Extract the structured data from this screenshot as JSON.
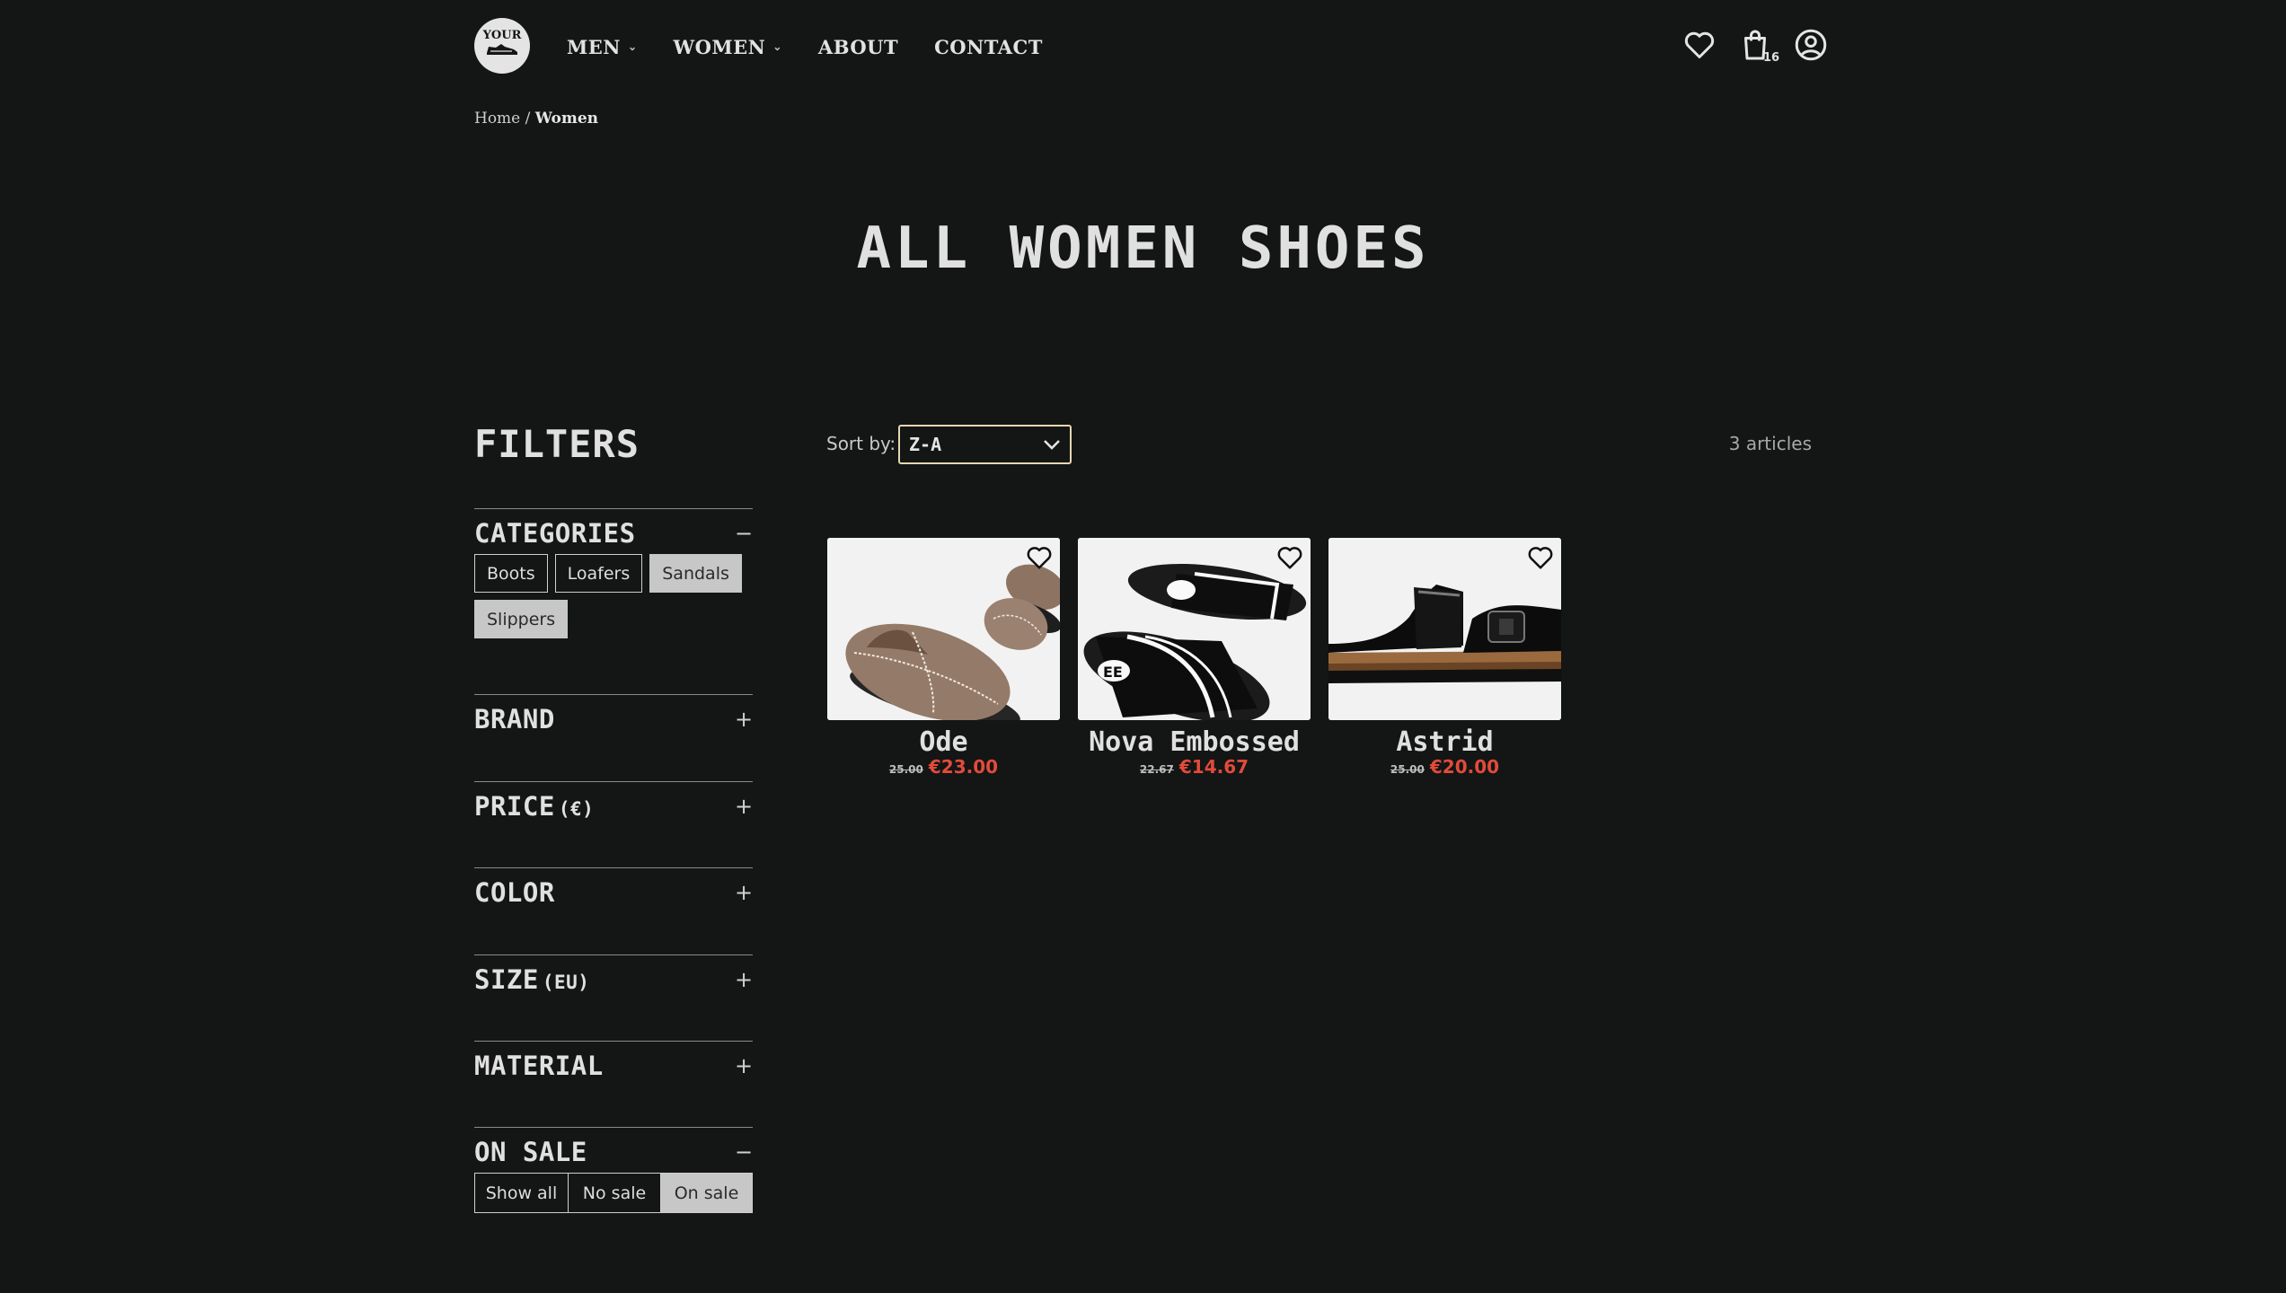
{
  "header": {
    "logo_text": "YOUR",
    "nav": [
      {
        "label": "MEN",
        "has_dropdown": true
      },
      {
        "label": "WOMEN",
        "has_dropdown": true
      },
      {
        "label": "ABOUT",
        "has_dropdown": false
      },
      {
        "label": "CONTACT",
        "has_dropdown": false
      }
    ],
    "icons": {
      "wishlist": "heart-icon",
      "cart": "shopping-bag-icon",
      "account": "user-icon"
    },
    "cart_count": "16"
  },
  "breadcrumb": {
    "home": "Home",
    "separator": " / ",
    "current": "Women"
  },
  "page_title": "ALL WOMEN SHOES",
  "filters": {
    "title": "FILTERS",
    "categories": {
      "label": "CATEGORIES",
      "toggle": "−",
      "options": [
        {
          "label": "Boots",
          "selected": false
        },
        {
          "label": "Loafers",
          "selected": false
        },
        {
          "label": "Sandals",
          "selected": true
        },
        {
          "label": "Slippers",
          "selected": true
        }
      ]
    },
    "brand": {
      "label": "BRAND",
      "toggle": "+"
    },
    "price": {
      "label": "PRICE",
      "unit": "(€)",
      "toggle": "+"
    },
    "color": {
      "label": "COLOR",
      "toggle": "+"
    },
    "size": {
      "label": "SIZE",
      "unit": "(EU)",
      "toggle": "+"
    },
    "material": {
      "label": "MATERIAL",
      "toggle": "+"
    },
    "on_sale": {
      "label": "ON SALE",
      "toggle": "−",
      "options": [
        "Show all",
        "No sale",
        "On sale"
      ],
      "selected": "On sale"
    }
  },
  "sort": {
    "label": "Sort by:",
    "value": "Z-A"
  },
  "results_count": "3 articles",
  "colors": {
    "sale": "#e24b3a",
    "select_border": "#e7d7b0",
    "background": "#141515"
  },
  "products": [
    {
      "name": "Ode",
      "old_price": "25.00",
      "price": "€23.00",
      "image": "suede-slipper"
    },
    {
      "name": "Nova Embossed",
      "old_price": "22.67",
      "price": "€14.67",
      "image": "black-slide-sandal"
    },
    {
      "name": "Astrid",
      "old_price": "25.00",
      "price": "€20.00",
      "image": "black-buckle-sandal"
    }
  ]
}
